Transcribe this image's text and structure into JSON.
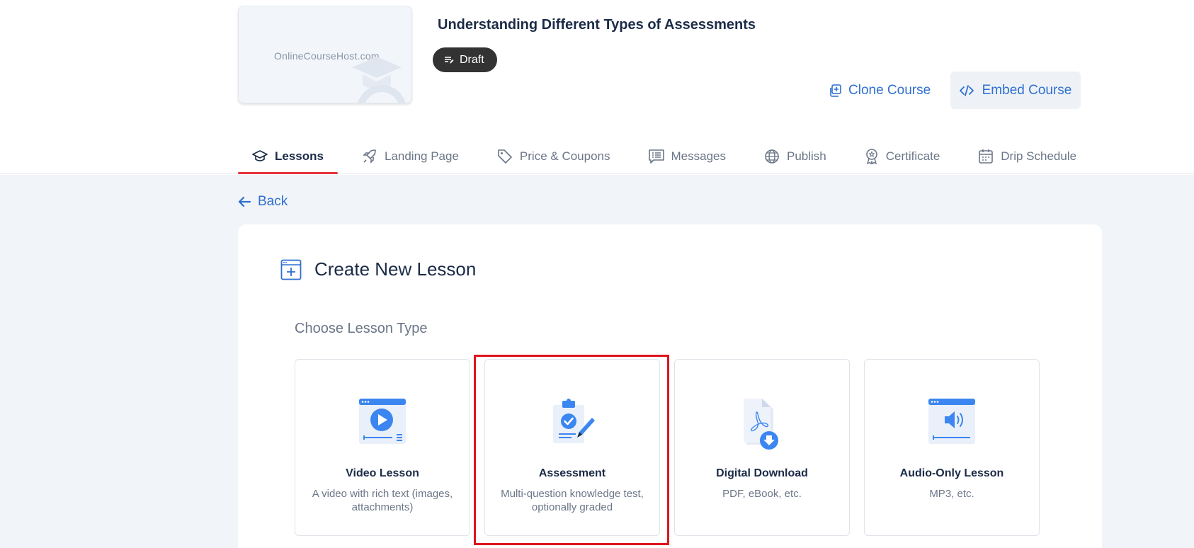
{
  "header": {
    "thumbnail_logo_text": "OnlineCourseHost.com",
    "course_title": "Understanding Different Types of Assessments",
    "status_badge": "Draft",
    "clone_label": "Clone Course",
    "embed_label": "Embed Course"
  },
  "tabs": [
    {
      "label": "Lessons",
      "icon": "graduation-cap-icon",
      "active": true
    },
    {
      "label": "Landing Page",
      "icon": "rocket-icon"
    },
    {
      "label": "Price & Coupons",
      "icon": "tag-icon"
    },
    {
      "label": "Messages",
      "icon": "message-list-icon"
    },
    {
      "label": "Publish",
      "icon": "globe-icon"
    },
    {
      "label": "Certificate",
      "icon": "award-icon"
    },
    {
      "label": "Drip Schedule",
      "icon": "calendar-icon"
    }
  ],
  "back_label": "Back",
  "create": {
    "title": "Create New Lesson",
    "subtitle": "Choose Lesson Type",
    "types": [
      {
        "name": "Video Lesson",
        "desc": "A video with rich text (images, attachments)",
        "icon": "video-player-icon"
      },
      {
        "name": "Assessment",
        "desc": "Multi-question knowledge test, optionally graded",
        "icon": "clipboard-check-icon"
      },
      {
        "name": "Digital Download",
        "desc": "PDF, eBook, etc.",
        "icon": "pdf-download-icon"
      },
      {
        "name": "Audio-Only Lesson",
        "desc": "MP3, etc.",
        "icon": "audio-player-icon"
      }
    ]
  },
  "colors": {
    "accent": "#2f6fd0",
    "active_tab_underline": "#e5333a",
    "highlight_box": "#e0141e",
    "badge_bg": "#333333"
  }
}
